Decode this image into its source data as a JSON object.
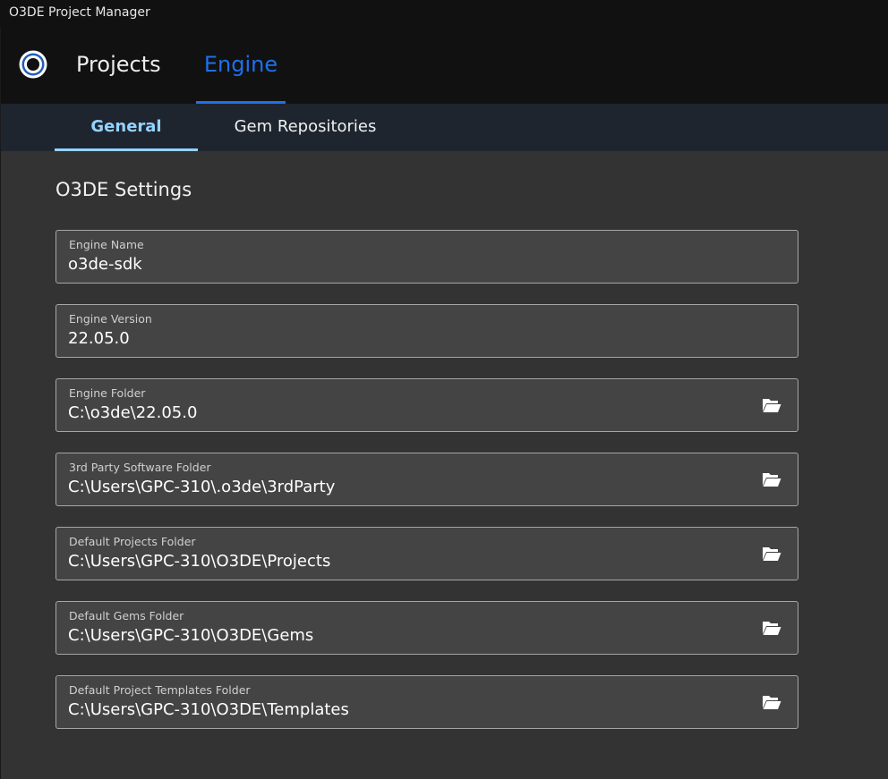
{
  "window": {
    "title": "O3DE Project Manager"
  },
  "header": {
    "logo_icon": "o3de-logo-icon",
    "tabs": [
      {
        "label": "Projects",
        "active": false
      },
      {
        "label": "Engine",
        "active": true
      }
    ]
  },
  "subtabs": [
    {
      "label": "General",
      "active": true
    },
    {
      "label": "Gem Repositories",
      "active": false
    }
  ],
  "main": {
    "section_title": "O3DE Settings",
    "fields": [
      {
        "label": "Engine Name",
        "value": "o3de-sdk",
        "has_browse": false
      },
      {
        "label": "Engine Version",
        "value": "22.05.0",
        "has_browse": false
      },
      {
        "label": "Engine Folder",
        "value": "C:\\o3de\\22.05.0",
        "has_browse": true
      },
      {
        "label": "3rd Party Software Folder",
        "value": "C:\\Users\\GPC-310\\.o3de\\3rdParty",
        "has_browse": true
      },
      {
        "label": "Default Projects Folder",
        "value": "C:\\Users\\GPC-310\\O3DE\\Projects",
        "has_browse": true
      },
      {
        "label": "Default Gems Folder",
        "value": "C:\\Users\\GPC-310\\O3DE\\Gems",
        "has_browse": true
      },
      {
        "label": "Default Project Templates Folder",
        "value": "C:\\Users\\GPC-310\\O3DE\\Templates",
        "has_browse": true
      }
    ],
    "browse_icon": "folder-open-icon"
  },
  "colors": {
    "accent_blue": "#1e70eb",
    "subtab_active": "#94d2ff",
    "background": "#333333",
    "header_bg": "#111111",
    "subbar_bg": "#1e252f",
    "field_bg": "#444444",
    "field_border": "#a6a6a6"
  }
}
